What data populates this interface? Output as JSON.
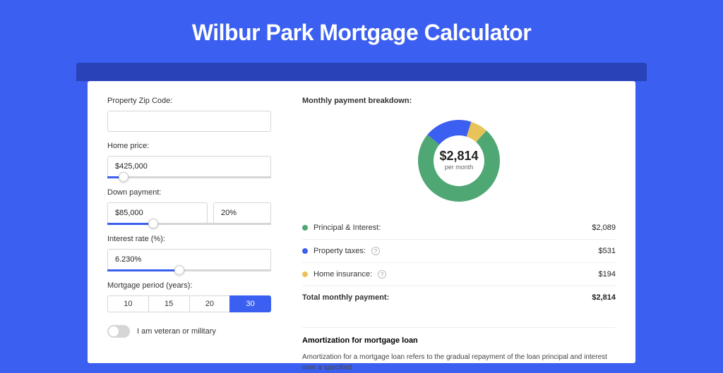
{
  "title": "Wilbur Park Mortgage Calculator",
  "form": {
    "zip_label": "Property Zip Code:",
    "zip_value": "",
    "home_price_label": "Home price:",
    "home_price_value": "$425,000",
    "home_price_slider_pct": 10,
    "down_payment_label": "Down payment:",
    "down_payment_value": "$85,000",
    "down_payment_pct_value": "20%",
    "down_payment_slider_pct": 28,
    "rate_label": "Interest rate (%):",
    "rate_value": "6.230%",
    "rate_slider_pct": 44,
    "period_label": "Mortgage period (years):",
    "periods": [
      "10",
      "15",
      "20",
      "30"
    ],
    "period_active": "30",
    "veteran_label": "I am veteran or military"
  },
  "breakdown": {
    "title": "Monthly payment breakdown:",
    "center_value": "$2,814",
    "center_sub": "per month",
    "items": [
      {
        "label": "Principal & Interest:",
        "value": "$2,089",
        "color": "green"
      },
      {
        "label": "Property taxes:",
        "value": "$531",
        "color": "blue",
        "info": true
      },
      {
        "label": "Home insurance:",
        "value": "$194",
        "color": "yellow",
        "info": true
      }
    ],
    "total_label": "Total monthly payment:",
    "total_value": "$2,814"
  },
  "chart_data": {
    "type": "pie",
    "title": "Monthly payment breakdown",
    "series": [
      {
        "name": "Principal & Interest",
        "value": 2089,
        "color": "#4fa774"
      },
      {
        "name": "Property taxes",
        "value": 531,
        "color": "#3b5ff0"
      },
      {
        "name": "Home insurance",
        "value": 194,
        "color": "#e8c35a"
      }
    ],
    "total": 2814,
    "center_label": "$2,814 per month",
    "inner_radius_ratio": 0.62
  },
  "amortization": {
    "title": "Amortization for mortgage loan",
    "text": "Amortization for a mortgage loan refers to the gradual repayment of the loan principal and interest over a specified"
  }
}
